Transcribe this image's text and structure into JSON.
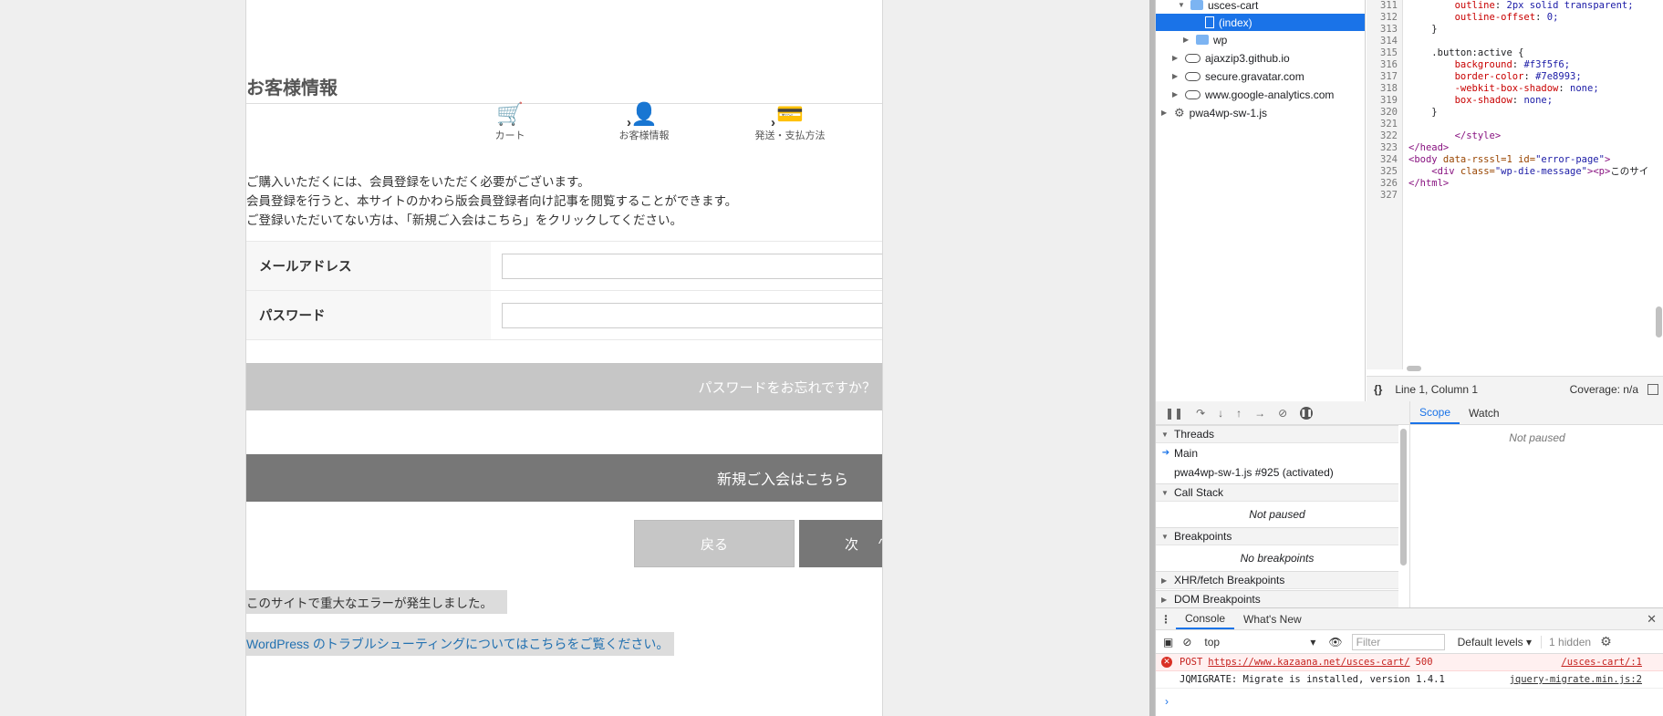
{
  "page": {
    "heading": "お客様情報",
    "steps": [
      {
        "icon": "cart-icon",
        "glyph": "🛒",
        "label": "カート"
      },
      {
        "icon": "user-edit-icon",
        "glyph": "👤",
        "label": "お客様情報"
      },
      {
        "icon": "credit-card-icon",
        "glyph": "💳",
        "label": "発送・支払方法"
      }
    ],
    "step_arrow": "›",
    "intro": [
      "ご購入いただくには、会員登録をいただく必要がございます。",
      "会員登録を行うと、本サイトのかわら版会員登録者向け記事を閲覧することができます。",
      "ご登録いただいてない方は、「新規ご入会はこちら」をクリックしてください。"
    ],
    "form": {
      "email_label": "メールアドレス",
      "email_value": "",
      "password_label": "パスワード",
      "password_value": ""
    },
    "forgot_button": "パスワードをお忘れですか？",
    "new_member_button": "新規ご入会はこちら",
    "back_button": "戻る",
    "next_button": "次",
    "next_chevron": "^",
    "error_message": "このサイトで重大なエラーが発生しました。",
    "troubleshoot_link": "WordPress のトラブルシューティングについてはこちらをご覧ください。"
  },
  "devtools": {
    "navigator": {
      "items": [
        {
          "name": "usces-cart",
          "kind": "folder",
          "expanded": true
        },
        {
          "name": "(index)",
          "kind": "file",
          "selected": true
        },
        {
          "name": "wp",
          "kind": "folder",
          "expanded": false
        },
        {
          "name": "ajaxzip3.github.io",
          "kind": "cloud"
        },
        {
          "name": "secure.gravatar.com",
          "kind": "cloud"
        },
        {
          "name": "www.google-analytics.com",
          "kind": "cloud"
        },
        {
          "name": "pwa4wp-sw-1.js",
          "kind": "gear"
        }
      ]
    },
    "editor": {
      "line_numbers": [
        "311",
        "312",
        "313",
        "314",
        "315",
        "316",
        "317",
        "318",
        "319",
        "320",
        "321",
        "322",
        "323",
        "324",
        "325",
        "326",
        "327"
      ],
      "lines": [
        {
          "indent": "        ",
          "prop": "outline",
          "val": "2px solid transparent;"
        },
        {
          "indent": "        ",
          "prop": "outline-offset",
          "val": "0;"
        },
        {
          "indent": "    ",
          "plain": "}"
        },
        {
          "indent": "",
          "plain": ""
        },
        {
          "indent": "    ",
          "plain": ".button:active {"
        },
        {
          "indent": "        ",
          "prop": "background",
          "val": "#f3f5f6;"
        },
        {
          "indent": "        ",
          "prop": "border-color",
          "val": "#7e8993;"
        },
        {
          "indent": "        ",
          "prop": "-webkit-box-shadow",
          "val": "none;"
        },
        {
          "indent": "        ",
          "prop": "box-shadow",
          "val": "none;"
        },
        {
          "indent": "    ",
          "plain": "}"
        },
        {
          "indent": "",
          "plain": ""
        },
        {
          "indent": "        ",
          "tag": "</style>"
        },
        {
          "indent": "",
          "tag": "</head>"
        },
        {
          "indent": "",
          "tag": "<body",
          "attrs": " data-rsssl=1 id=",
          "aval": "\"error-page\"",
          "end": ">"
        },
        {
          "indent": "    ",
          "tag": "<div",
          "attrs": " class=",
          "aval": "\"wp-die-message\"",
          "end": "><p>",
          "rest": "このサイ"
        },
        {
          "indent": "",
          "tag": "</html>"
        },
        {
          "indent": "",
          "plain": ""
        }
      ],
      "status_brace": "{}",
      "cursor": "Line 1, Column 1",
      "coverage": "Coverage: n/a"
    },
    "debugger": {
      "scope_tab": "Scope",
      "watch_tab": "Watch",
      "scope_status": "Not paused",
      "threads_label": "Threads",
      "threads": [
        "Main",
        "pwa4wp-sw-1.js #925 (activated)"
      ],
      "call_stack_label": "Call Stack",
      "call_stack_status": "Not paused",
      "breakpoints_label": "Breakpoints",
      "breakpoints_status": "No breakpoints",
      "xhr_label": "XHR/fetch Breakpoints",
      "dom_label": "DOM Breakpoints"
    },
    "drawer": {
      "console_tab": "Console",
      "whats_new_tab": "What's New",
      "context": "top",
      "filter_placeholder": "Filter",
      "levels": "Default levels ▾",
      "hidden": "1 hidden",
      "messages": [
        {
          "level": "error",
          "method": "POST",
          "url": "https://www.kazaana.net/usces-cart/",
          "status": "500",
          "source": "/usces-cart/:1"
        },
        {
          "level": "log",
          "text": "JQMIGRATE: Migrate is installed, version 1.4.1",
          "source": "jquery-migrate.min.js:2"
        }
      ],
      "prompt": "›"
    }
  },
  "colors": {
    "selection": "#1a73e8",
    "error_text": "#c5221f",
    "link": "#2271b1"
  }
}
